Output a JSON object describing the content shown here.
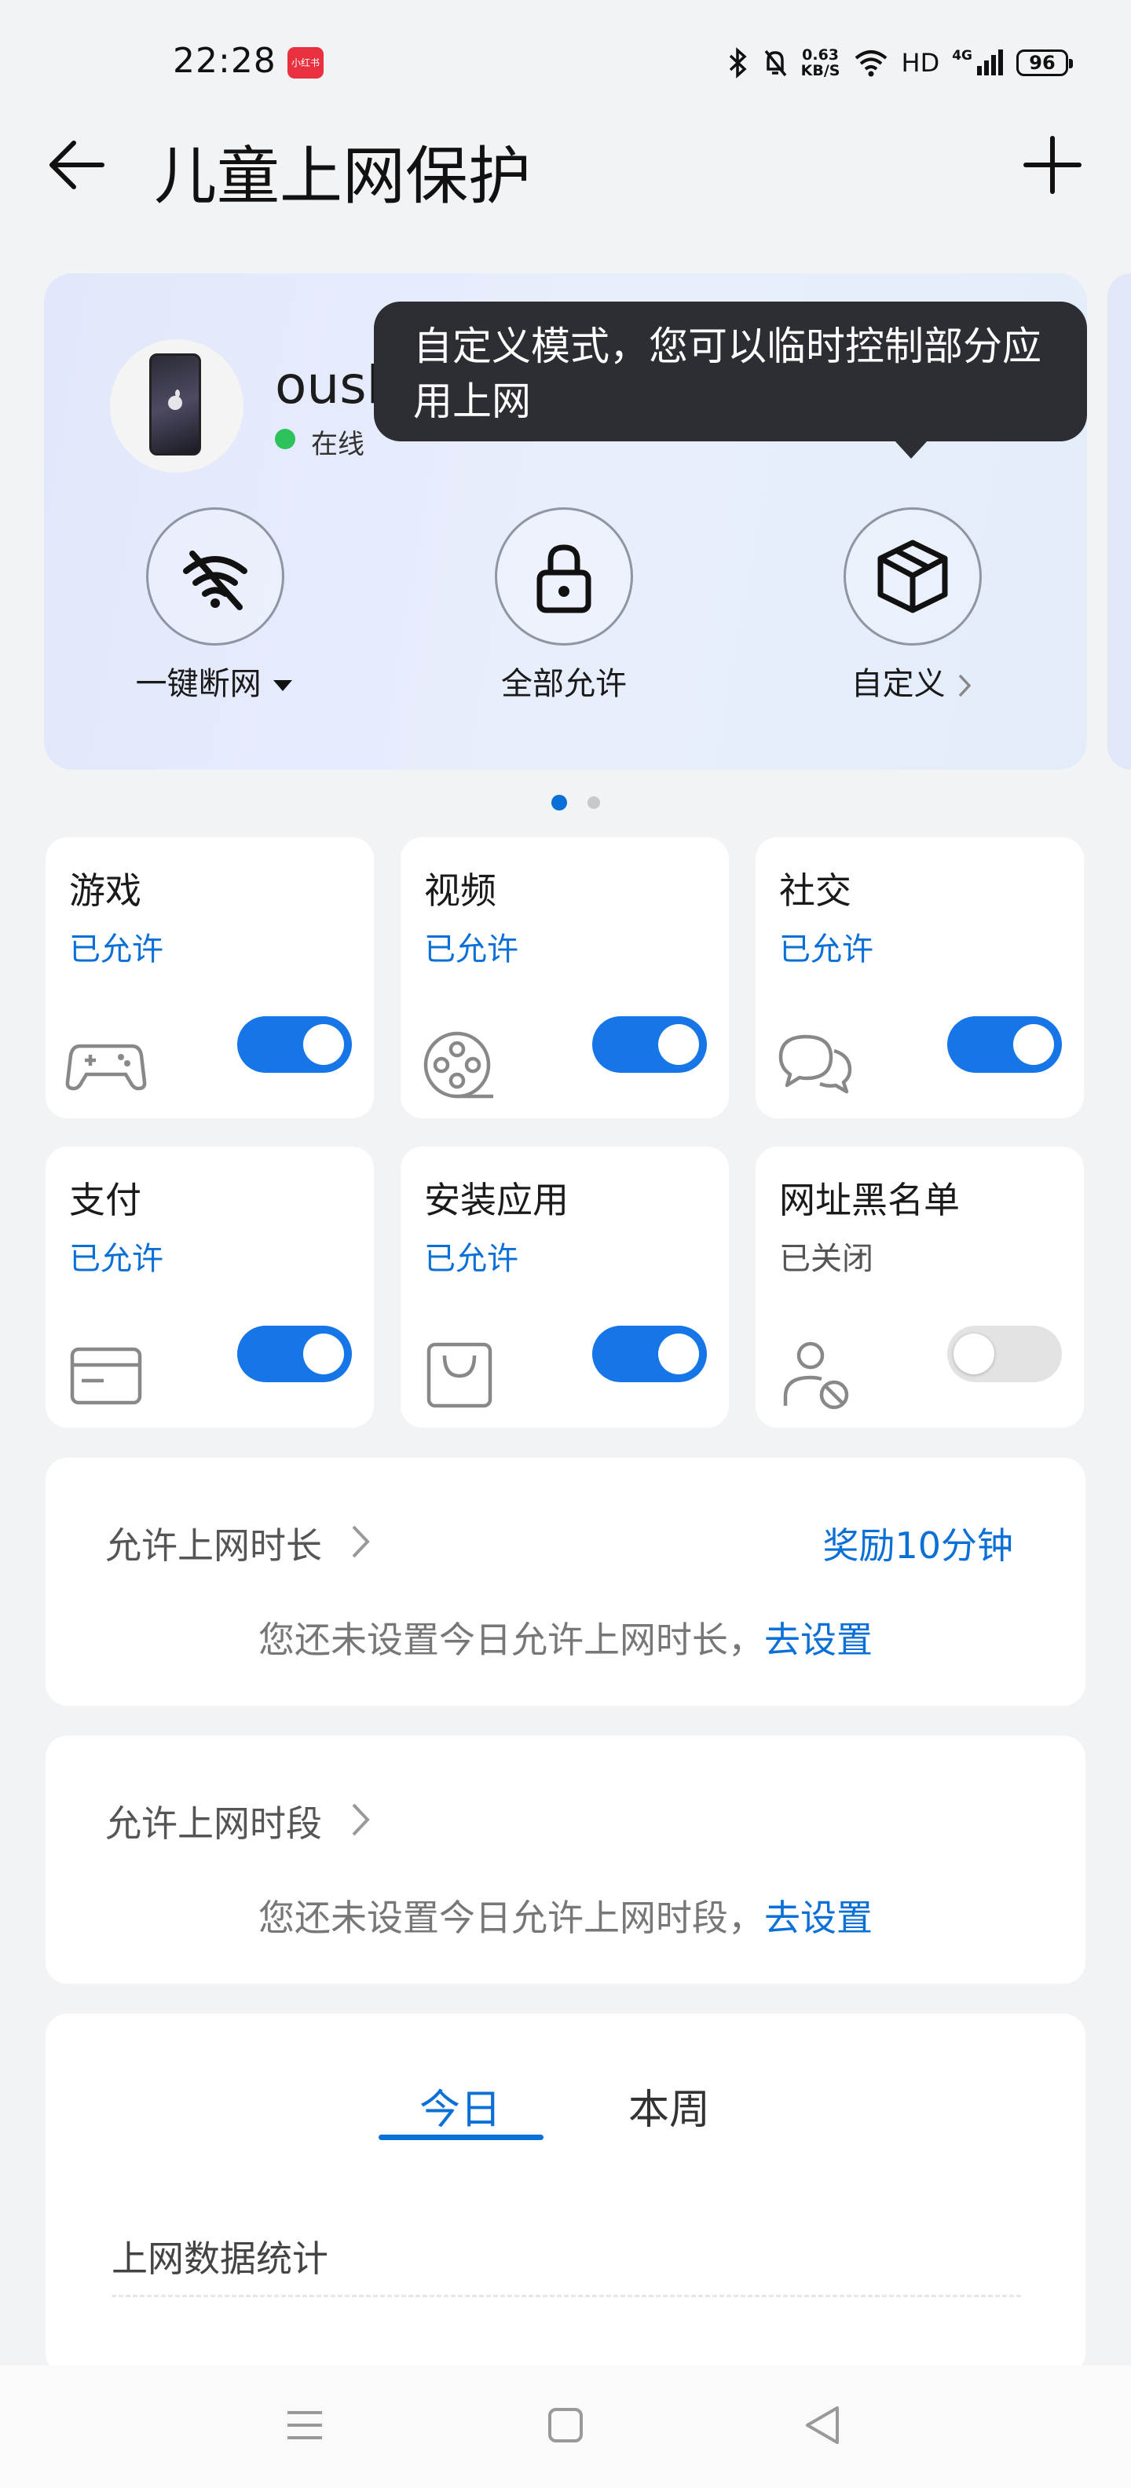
{
  "status_bar": {
    "time": "22:28",
    "app_badge": "小红书",
    "net_speed_value": "0.63",
    "net_speed_unit": "KB/S",
    "hd": "HD",
    "network": "4G",
    "battery": "96"
  },
  "header": {
    "title": "儿童上网保护",
    "back_icon": "arrow-left-icon",
    "add_icon": "plus-icon"
  },
  "device": {
    "name": "oushunde iphone",
    "status": "在线",
    "status_color": "#2ec25c"
  },
  "tooltip": {
    "text": "自定义模式，您可以临时控制部分应用上网"
  },
  "modes": [
    {
      "label": "一键断网",
      "icon": "wifi-off-icon"
    },
    {
      "label": "全部允许",
      "icon": "lock-icon"
    },
    {
      "label": "自定义",
      "icon": "cube-icon"
    }
  ],
  "pager": {
    "total": 2,
    "active": 1
  },
  "categories": [
    {
      "title": "游戏",
      "status": "已允许",
      "enabled": true,
      "icon": "gamepad-icon"
    },
    {
      "title": "视频",
      "status": "已允许",
      "enabled": true,
      "icon": "film-reel-icon"
    },
    {
      "title": "社交",
      "status": "已允许",
      "enabled": true,
      "icon": "chat-bubbles-icon"
    },
    {
      "title": "支付",
      "status": "已允许",
      "enabled": true,
      "icon": "card-icon"
    },
    {
      "title": "安装应用",
      "status": "已允许",
      "enabled": true,
      "icon": "shopping-bag-icon"
    },
    {
      "title": "网址黑名单",
      "status": "已关闭",
      "enabled": false,
      "icon": "user-blocked-icon"
    }
  ],
  "time_limit": {
    "title": "允许上网时长",
    "action": "奖励10分钟",
    "message": "您还未设置今日允许上网时长，",
    "link": "去设置"
  },
  "time_period": {
    "title": "允许上网时段",
    "message": "您还未设置今日允许上网时段，",
    "link": "去设置"
  },
  "stats": {
    "tabs": [
      "今日",
      "本周"
    ],
    "active_tab": 0,
    "title": "上网数据统计"
  },
  "navbar": {
    "menu_icon": "menu-icon",
    "home_icon": "home-square-icon",
    "back_icon": "back-triangle-icon"
  },
  "colors": {
    "accent": "#0a6fd6",
    "toggle_on": "#1676e8",
    "tooltip_bg": "#2c2e33"
  }
}
